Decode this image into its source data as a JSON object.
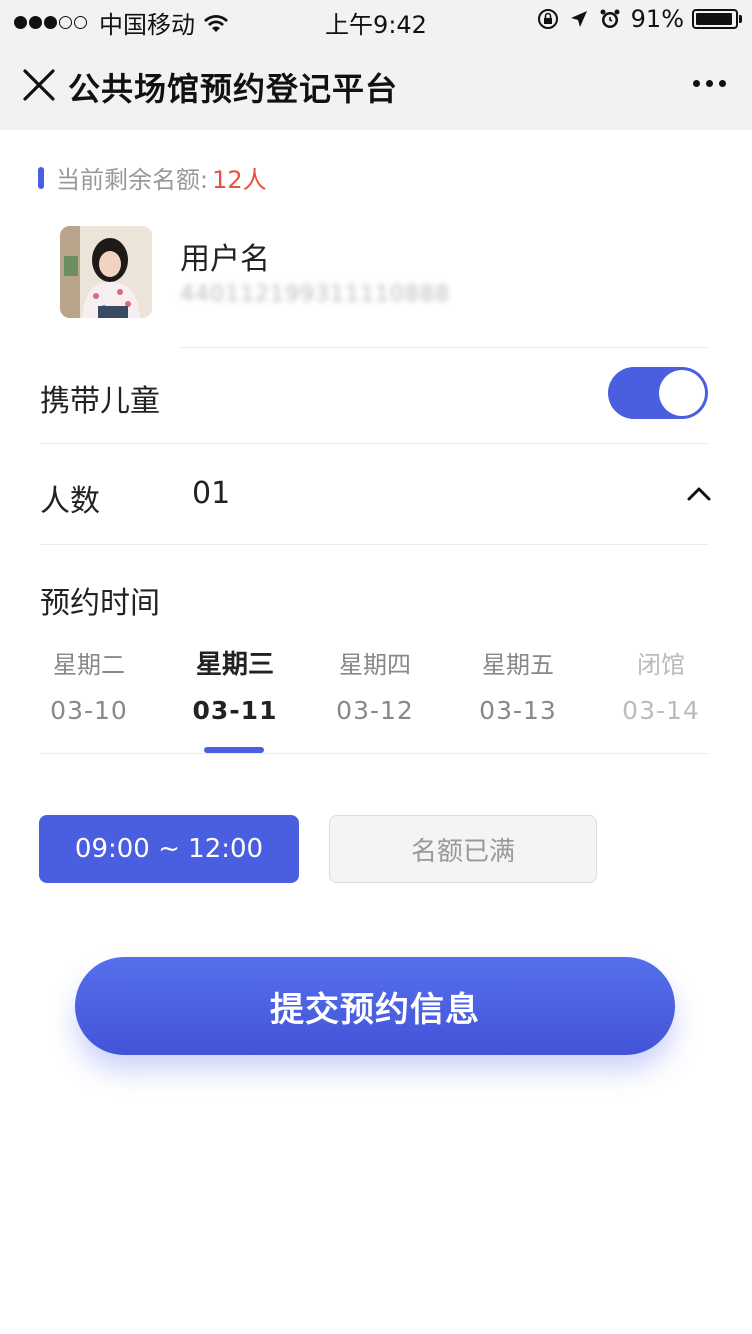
{
  "status_bar": {
    "carrier": "中国移动",
    "time": "上午9:42",
    "battery": "91%"
  },
  "nav": {
    "title": "公共场馆预约登记平台"
  },
  "quota": {
    "label": "当前剩余名额:",
    "value": "12人"
  },
  "user": {
    "name": "用户名",
    "id": "440112199311110888"
  },
  "carry_children": {
    "label": "携带儿童",
    "enabled": true
  },
  "people": {
    "label": "人数",
    "value": "01"
  },
  "reservation": {
    "label": "预约时间",
    "days": [
      {
        "name": "星期二",
        "date": "03-10"
      },
      {
        "name": "星期三",
        "date": "03-11"
      },
      {
        "name": "星期四",
        "date": "03-12"
      },
      {
        "name": "星期五",
        "date": "03-13"
      },
      {
        "name": "闭馆",
        "date": "03-14"
      }
    ],
    "selected_day_index": 1,
    "slots": [
      {
        "label": "09:00 ~ 12:00",
        "state": "selected"
      },
      {
        "label": "名额已满",
        "state": "full"
      }
    ]
  },
  "submit": {
    "label": "提交预约信息"
  },
  "colors": {
    "accent": "#4a5fe0",
    "quota_value": "#e5533d"
  }
}
